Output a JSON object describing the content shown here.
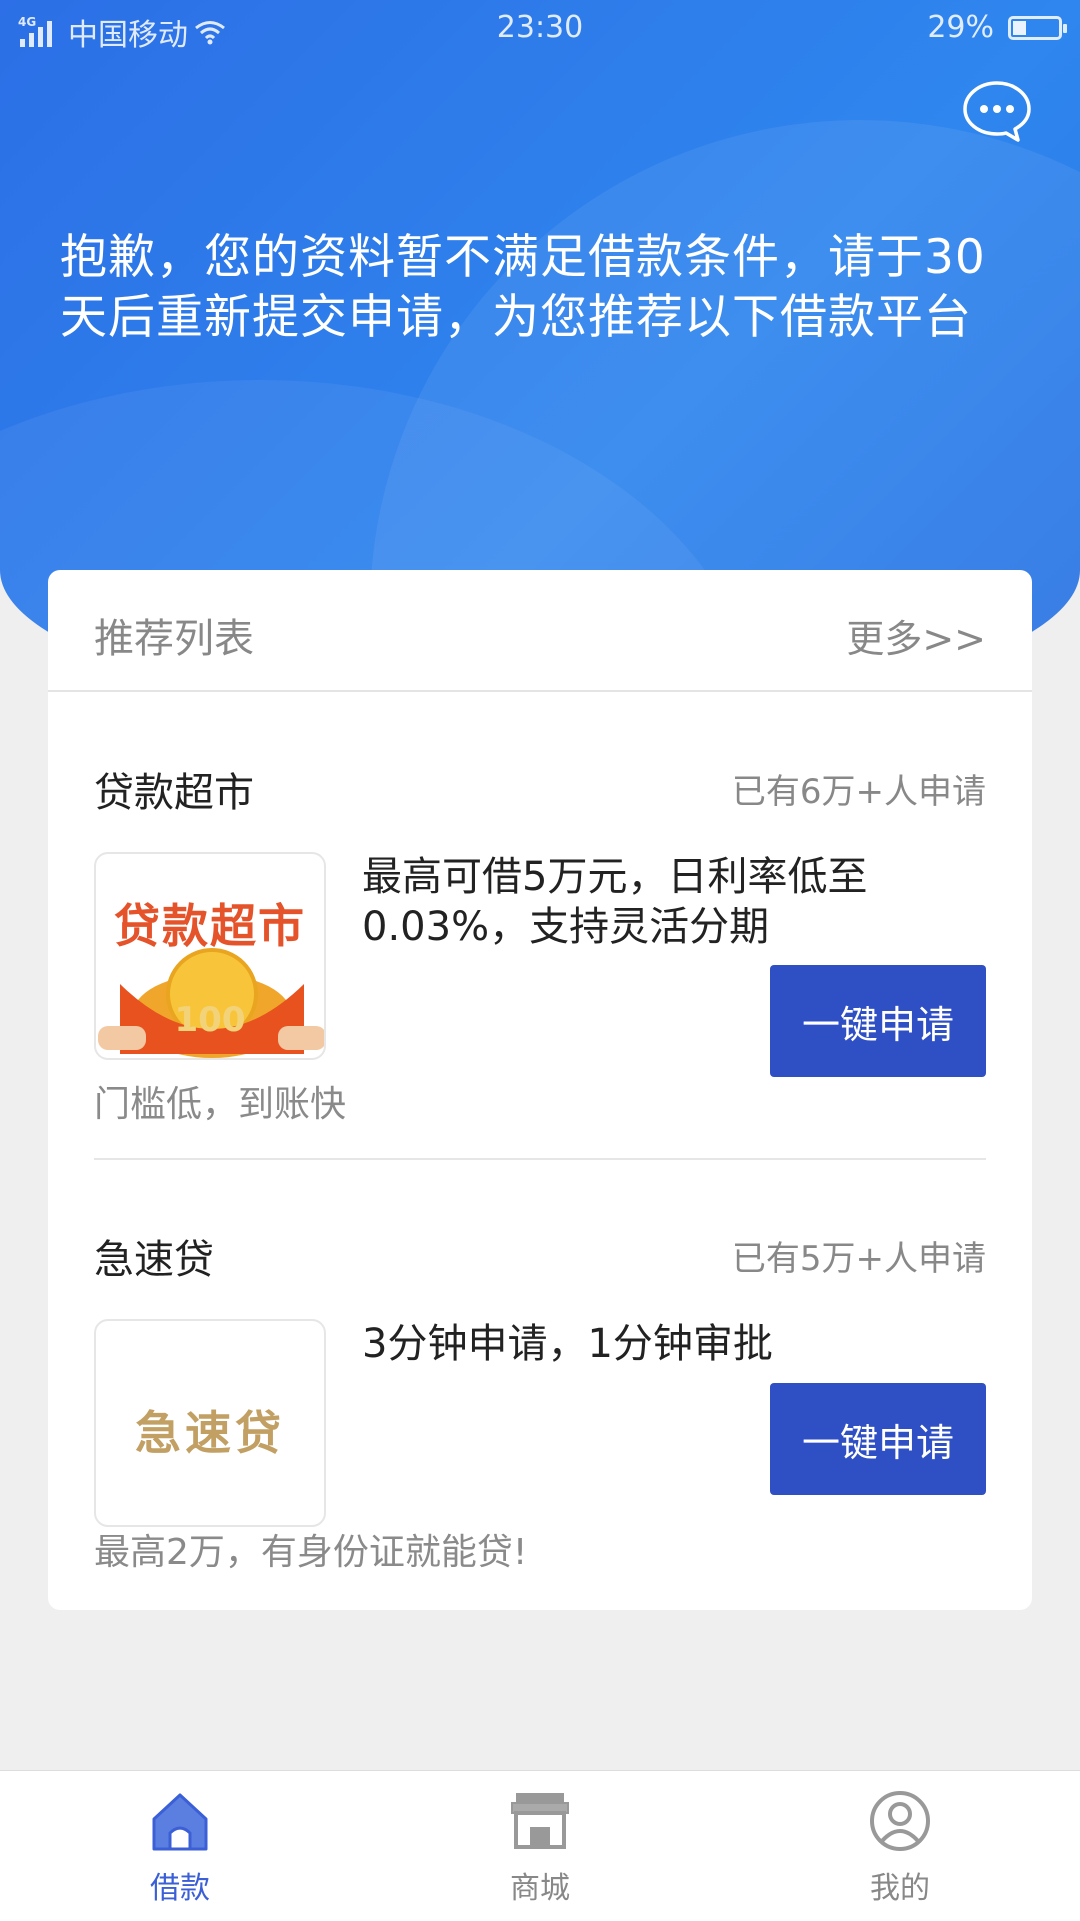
{
  "status_bar": {
    "network": "4G",
    "carrier": "中国移动",
    "time": "23:30",
    "battery": "29%",
    "battery_level": 0.29
  },
  "header": {
    "notice": "抱歉，您的资料暂不满足借款条件，请于30天后重新提交申请，为您推荐以下借款平台"
  },
  "recommend": {
    "title": "推荐列表",
    "more": "更多>>",
    "items": [
      {
        "name": "贷款超市",
        "count": "已有6万+人申请",
        "logo_text": "贷款超市",
        "logo_coin": "100",
        "desc": "最高可借5万元，日利率低至0.03%，支持灵活分期",
        "button": "一键申请",
        "tagline": "门槛低，到账快"
      },
      {
        "name": "急速贷",
        "count": "已有5万+人申请",
        "logo_text": "急速贷",
        "desc": "3分钟申请，1分钟审批",
        "button": "一键申请",
        "tagline": "最高2万，有身份证就能贷!"
      }
    ]
  },
  "tabbar": {
    "tabs": [
      {
        "label": "借款",
        "icon": "home-icon",
        "active": true
      },
      {
        "label": "商城",
        "icon": "shop-icon",
        "active": false
      },
      {
        "label": "我的",
        "icon": "user-icon",
        "active": false
      }
    ]
  },
  "colors": {
    "primary": "#2f4fc4",
    "header_blue": "#2c7be9",
    "active_tab": "#3b5fd6",
    "muted_text": "#888888"
  }
}
